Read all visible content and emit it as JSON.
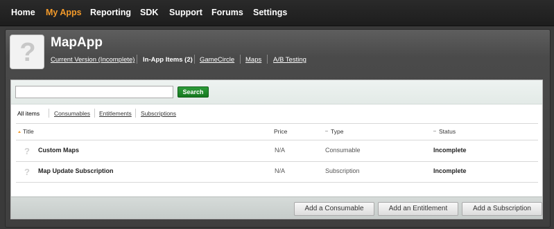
{
  "topnav": {
    "items": [
      {
        "label": "Home",
        "active": false
      },
      {
        "label": "My Apps",
        "active": true
      },
      {
        "label": "Reporting",
        "active": false
      },
      {
        "label": "SDK",
        "active": false
      },
      {
        "label": "Support",
        "active": false
      },
      {
        "label": "Forums",
        "active": false
      },
      {
        "label": "Settings",
        "active": false
      }
    ]
  },
  "app": {
    "icon_glyph": "?",
    "title": "MapApp",
    "tabs": [
      {
        "label": "Current Version (Incomplete)",
        "current": false
      },
      {
        "label": "In-App Items (2)",
        "current": true
      },
      {
        "label": "GameCircle",
        "current": false
      },
      {
        "label": "Maps",
        "current": false
      },
      {
        "label": "A/B Testing",
        "current": false
      }
    ]
  },
  "search": {
    "placeholder": "",
    "value": "",
    "button_label": "Search"
  },
  "filters": [
    {
      "label": "All items",
      "current": true
    },
    {
      "label": "Consumables",
      "current": false
    },
    {
      "label": "Entitlements",
      "current": false
    },
    {
      "label": "Subscriptions",
      "current": false
    }
  ],
  "table": {
    "columns": [
      "Title",
      "Price",
      "Type",
      "Status"
    ],
    "sorted_column": "Title",
    "rows": [
      {
        "icon": "?",
        "title": "Custom Maps",
        "price": "N/A",
        "type": "Consumable",
        "status": "Incomplete"
      },
      {
        "icon": "?",
        "title": "Map Update Subscription",
        "price": "N/A",
        "type": "Subscription",
        "status": "Incomplete"
      }
    ]
  },
  "actions": {
    "add_consumable": "Add a Consumable",
    "add_entitlement": "Add an Entitlement",
    "add_subscription": "Add a Subscription"
  },
  "colors": {
    "accent": "#f39a2a",
    "search_button": "#1f8a2b",
    "nav_background": "#222222"
  },
  "icons": [
    "question-mark-icon",
    "sort-ascending-icon"
  ]
}
